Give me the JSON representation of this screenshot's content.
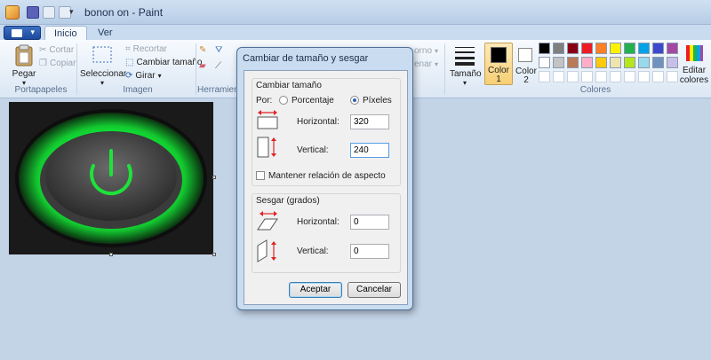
{
  "window": {
    "title": "bonon on - Paint"
  },
  "qat": {
    "dropdown": "▾"
  },
  "tabs": [
    {
      "label": "Inicio"
    },
    {
      "label": "Ver"
    }
  ],
  "ribbon": {
    "clipboard": {
      "paste_label": "Pegar",
      "cut_label": "Cortar",
      "copy_label": "Copiar",
      "group_label": "Portapapeles"
    },
    "image": {
      "select_label": "Seleccionar",
      "crop_label": "Recortar",
      "resize_label": "Cambiar tamaño",
      "rotate_label": "Girar",
      "group_label": "Imagen"
    },
    "tools": {
      "group_label": "Herramienta"
    },
    "hidden_texts": {
      "outline": "orno",
      "fill": "enar"
    },
    "size": {
      "label": "Tamaño"
    },
    "color1": {
      "label": "Color",
      "sub": "1",
      "value": "#000000"
    },
    "color2": {
      "label": "Color",
      "sub": "2",
      "value": "#ffffff"
    },
    "edit_colors": {
      "label": "Editar",
      "sub": "colores"
    },
    "colors_group_label": "Colores",
    "palette_row1": [
      "#000000",
      "#7f7f7f",
      "#880015",
      "#ed1c24",
      "#ff7f27",
      "#fff200",
      "#22b14c",
      "#00a2e8",
      "#3f48cc",
      "#a349a4"
    ],
    "palette_row2": [
      "#ffffff",
      "#c3c3c3",
      "#b97a57",
      "#ffaec9",
      "#ffc90e",
      "#efe4b0",
      "#b5e61d",
      "#99d9ea",
      "#7092be",
      "#c8bfe7"
    ]
  },
  "dialog": {
    "title": "Cambiar de tamaño y sesgar",
    "resize": {
      "legend": "Cambiar tamaño",
      "by_label": "Por:",
      "percent_label": "Porcentaje",
      "pixels_label": "Píxeles",
      "selected": "pixels",
      "horizontal_label": "Horizontal:",
      "horizontal_value": "320",
      "vertical_label": "Vertical:",
      "vertical_value": "240",
      "keep_ratio_label": "Mantener relación de aspecto",
      "keep_ratio_checked": false
    },
    "skew": {
      "legend": "Sesgar (grados)",
      "horizontal_label": "Horizontal:",
      "horizontal_value": "0",
      "vertical_label": "Vertical:",
      "vertical_value": "0"
    },
    "ok_label": "Aceptar",
    "cancel_label": "Cancelar"
  }
}
